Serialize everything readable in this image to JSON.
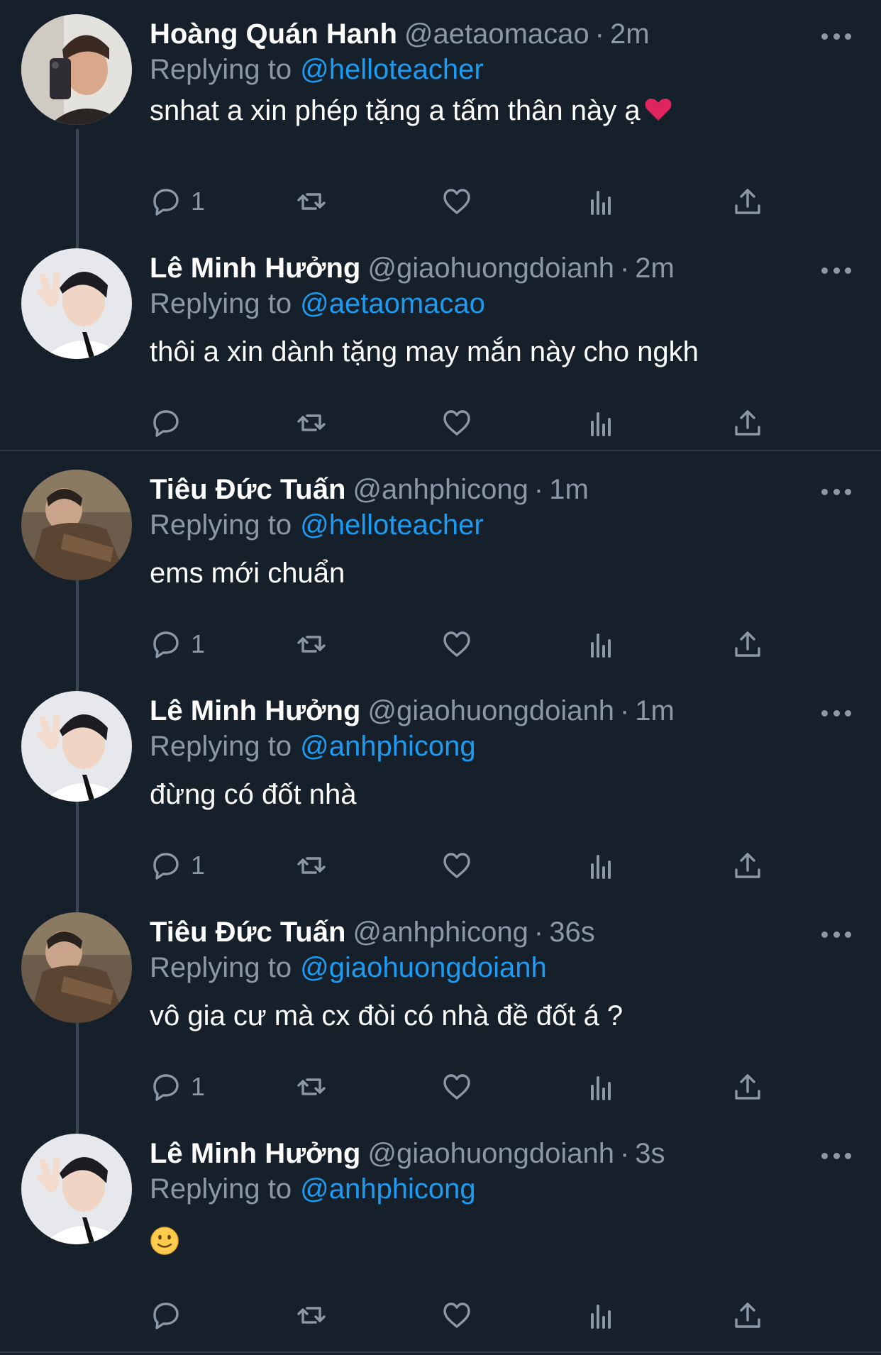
{
  "colors": {
    "background": "#16202b",
    "text": "#ffffff",
    "muted": "#8b98a5",
    "link": "#1d9bf0",
    "thread_line": "#3a4653",
    "heart": "#e0245e"
  },
  "replying_label": "Replying to",
  "dot": "·",
  "icons": [
    "reply-icon",
    "retweet-icon",
    "like-icon",
    "views-icon",
    "share-icon",
    "more-icon"
  ],
  "tweets": [
    {
      "name": "Hoàng Quán Hanh",
      "handle": "@aetaomacao",
      "time": "2m",
      "reply_to": "@helloteacher",
      "text": "snhat a xin phép tặng a tấm thân này ạ",
      "emoji": "red-heart",
      "reply_count": "1",
      "avatar": "avatar-mirror-selfie"
    },
    {
      "name": "Lê Minh Hưởng",
      "handle": "@giaohuongdoianh",
      "time": "2m",
      "reply_to": "@aetaomacao",
      "text": "thôi a xin dành tặng may mắn này cho ngkh",
      "reply_count": "",
      "avatar": "avatar-peace-sign"
    },
    {
      "name": "Tiêu Đức Tuấn",
      "handle": "@anhphicong",
      "time": "1m",
      "reply_to": "@helloteacher",
      "text": "ems mới chuẩn",
      "reply_count": "1",
      "avatar": "avatar-brown-jacket"
    },
    {
      "name": "Lê Minh Hưởng",
      "handle": "@giaohuongdoianh",
      "time": "1m",
      "reply_to": "@anhphicong",
      "text": "đừng có đốt nhà",
      "reply_count": "1",
      "avatar": "avatar-peace-sign"
    },
    {
      "name": "Tiêu Đức Tuấn",
      "handle": "@anhphicong",
      "time": "36s",
      "reply_to": "@giaohuongdoianh",
      "text": "vô gia cư mà cx đòi có nhà đề đốt á ?",
      "reply_count": "1",
      "avatar": "avatar-brown-jacket"
    },
    {
      "name": "Lê Minh Hưởng",
      "handle": "@giaohuongdoianh",
      "time": "3s",
      "reply_to": "@anhphicong",
      "text": "",
      "emoji": "slightly-smiling-face",
      "reply_count": "",
      "avatar": "avatar-peace-sign"
    }
  ]
}
